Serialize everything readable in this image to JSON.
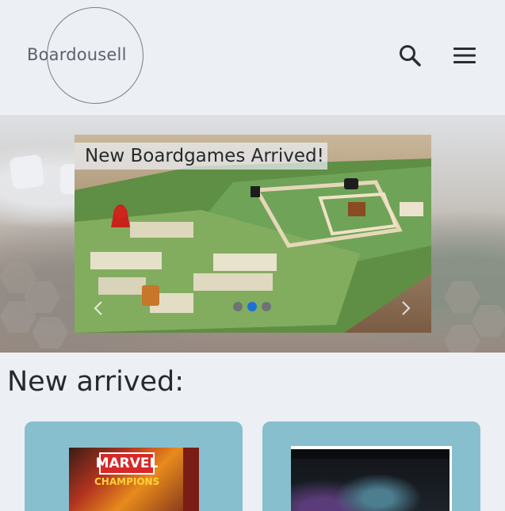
{
  "header": {
    "brand": "Boardousell",
    "search_icon": "search-icon",
    "menu_icon": "hamburger-menu-icon"
  },
  "carousel": {
    "caption": "New Boardgames Arrived!",
    "prev_icon": "chevron-left-icon",
    "next_icon": "chevron-right-icon",
    "slide_count": 3,
    "active_slide": 2
  },
  "new_arrived": {
    "title": "New arrived:",
    "products": [
      {
        "box_title": "MARVEL",
        "box_subtitle": "CHAMPIONS"
      },
      {
        "box_title": ""
      }
    ]
  },
  "colors": {
    "background": "#eceff4",
    "card": "#88bfcf",
    "active_dot": "#1f6fd8"
  }
}
